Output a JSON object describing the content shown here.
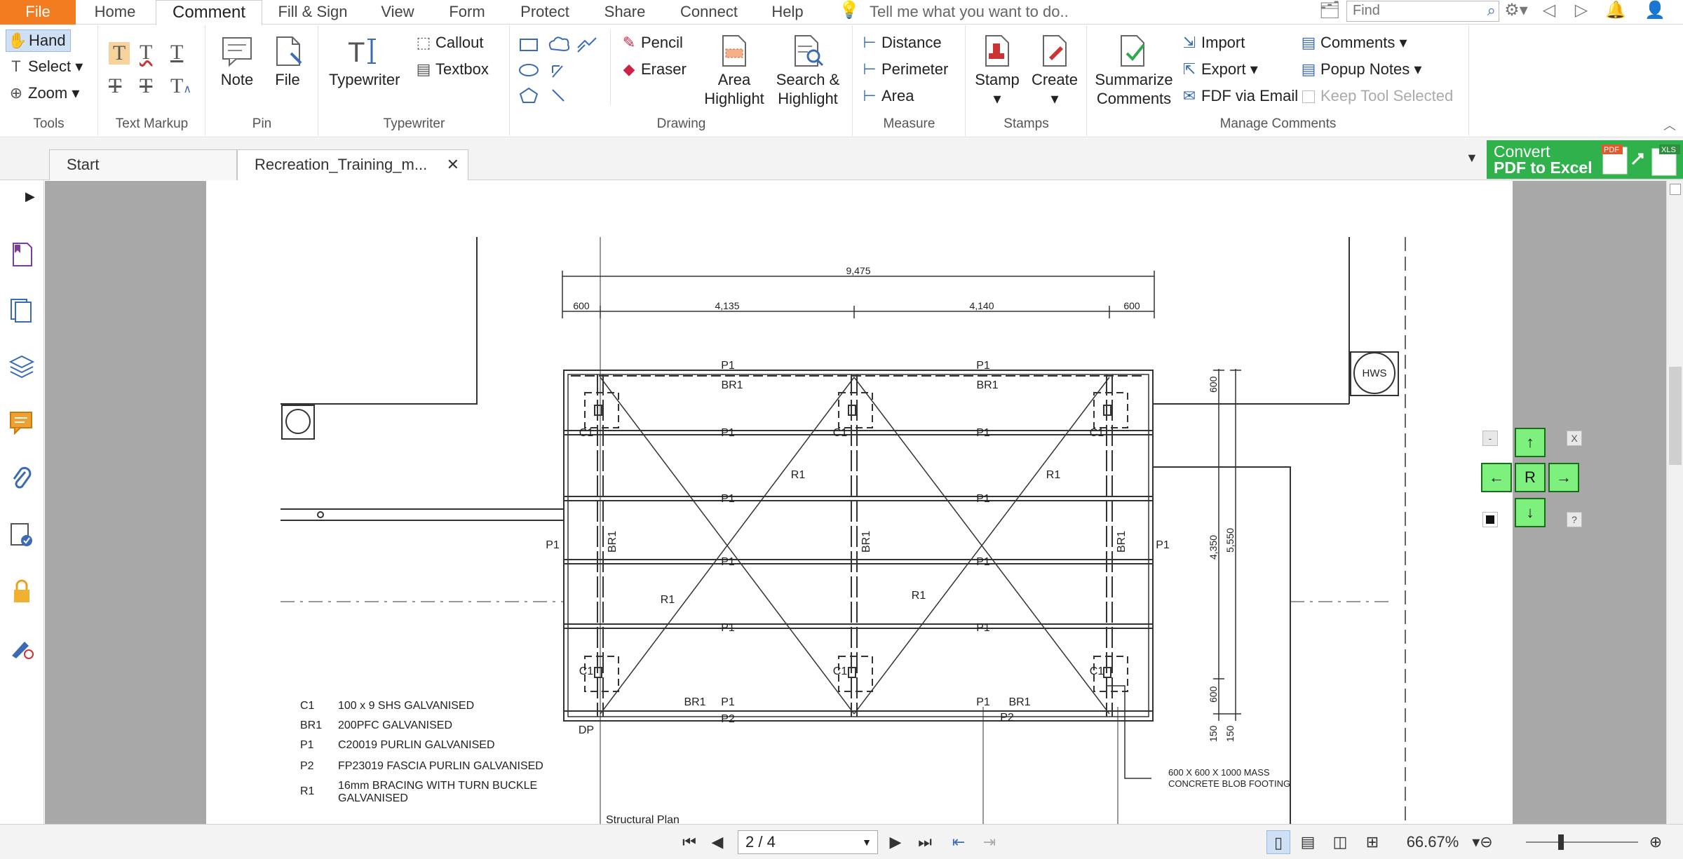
{
  "menu": {
    "tabs": [
      "File",
      "Home",
      "Comment",
      "Fill & Sign",
      "View",
      "Form",
      "Protect",
      "Share",
      "Connect",
      "Help"
    ],
    "active": "Comment",
    "tell_me": "Tell me what you want to do..",
    "find_placeholder": "Find"
  },
  "ribbon": {
    "tools": {
      "label": "Tools",
      "hand": "Hand",
      "select": "Select",
      "zoom": "Zoom"
    },
    "text_markup": {
      "label": "Text Markup"
    },
    "pin": {
      "label": "Pin",
      "note": "Note",
      "file": "File"
    },
    "typewriter": {
      "label": "Typewriter",
      "typewriter": "Typewriter",
      "callout": "Callout",
      "textbox": "Textbox"
    },
    "drawing": {
      "label": "Drawing",
      "pencil": "Pencil",
      "eraser": "Eraser",
      "area_highlight_1": "Area",
      "area_highlight_2": "Highlight",
      "search_highlight_1": "Search &",
      "search_highlight_2": "Highlight"
    },
    "measure": {
      "label": "Measure",
      "distance": "Distance",
      "perimeter": "Perimeter",
      "area": "Area"
    },
    "stamps": {
      "label": "Stamps",
      "stamp": "Stamp",
      "create": "Create"
    },
    "manage": {
      "label": "Manage Comments",
      "summarize_1": "Summarize",
      "summarize_2": "Comments",
      "import": "Import",
      "export": "Export",
      "fdf_email": "FDF via Email",
      "comments": "Comments",
      "popup_notes": "Popup Notes",
      "keep_tool": "Keep Tool Selected"
    }
  },
  "doc_tabs": [
    "Start",
    "Recreation_Training_m..."
  ],
  "convert": {
    "line1": "Convert",
    "line2": "PDF to Excel",
    "badge_pdf": "PDF",
    "badge_xls": "XLS"
  },
  "drawing": {
    "dims_top": {
      "overall": "9,475",
      "d1": "600",
      "d2": "4,135",
      "d3": "4,140",
      "d4": "600"
    },
    "dims_right": {
      "a": "600",
      "b": "4,350",
      "c": "5,550",
      "d": "600",
      "e": "150",
      "f": "150"
    },
    "labels": {
      "p1": "P1",
      "p2": "P2",
      "br1": "BR1",
      "r1": "R1",
      "c1": "C1",
      "dp": "DP",
      "hws": "HWS"
    },
    "footing_1": "600 X 600 X 1000 MASS",
    "footing_2": "CONCRETE BLOB FOOTING",
    "plan_title": "Structural Plan",
    "legend": [
      {
        "code": "C1",
        "desc": "100 x 9 SHS GALVANISED"
      },
      {
        "code": "BR1",
        "desc": "200PFC GALVANISED"
      },
      {
        "code": "P1",
        "desc": "C20019 PURLIN GALVANISED"
      },
      {
        "code": "P2",
        "desc": "FP23019 FASCIA PURLIN GALVANISED"
      },
      {
        "code": "R1",
        "desc": "16mm BRACING WITH TURN BUCKLE",
        "desc2": "GALVANISED"
      }
    ]
  },
  "nav_widget": {
    "up": "↑",
    "down": "↓",
    "left": "←",
    "right": "→",
    "center": "R",
    "minus": "-",
    "close": "X",
    "help": "?"
  },
  "status": {
    "page": "2 / 4",
    "zoom": "66.67%"
  }
}
